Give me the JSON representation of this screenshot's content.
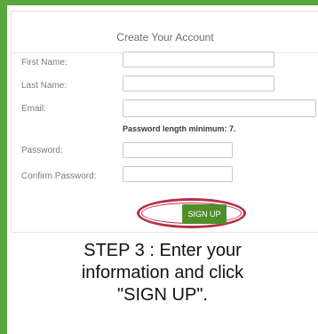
{
  "form": {
    "title": "Create Your Account",
    "first_name_label": "First Name:",
    "last_name_label": "Last Name:",
    "email_label": "Email:",
    "password_hint": "Password length minimum: 7.",
    "password_label": "Password:",
    "confirm_password_label": "Confirm Password:",
    "first_name_value": "",
    "last_name_value": "",
    "email_value": "",
    "password_value": "",
    "confirm_password_value": "",
    "signup_label": "SIGN UP"
  },
  "caption": {
    "line1": "STEP 3 : Enter your",
    "line2": "information and click",
    "line3": "\"SIGN UP\"."
  },
  "colors": {
    "background_green": "#5aa83d",
    "button_green": "#4f8f2a",
    "highlight_ring": "#b5314a"
  }
}
